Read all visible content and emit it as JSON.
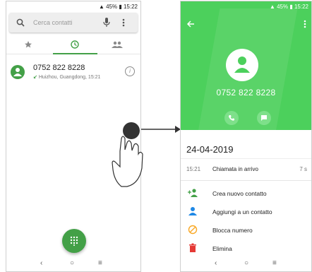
{
  "left_phone": {
    "status": {
      "text": "▲  45% ▮ 15:22"
    },
    "search": {
      "placeholder": "Cerca contatti"
    },
    "tabs": [
      "favorites",
      "recent",
      "contacts"
    ],
    "call_log": [
      {
        "number": "0752 822 8228",
        "detail": "Huizhou, Guangdong, 15:21"
      }
    ],
    "navbar": [
      "‹",
      "○",
      "≡"
    ]
  },
  "right_phone": {
    "status": {
      "text": "▲  45% ▮ 15:22"
    },
    "contact_number": "0752 822 8228",
    "date": "24-04-2019",
    "call": {
      "time": "15:21",
      "type": "Chiamata in arrivo",
      "duration": "7 s"
    },
    "actions": [
      {
        "label": "Crea nuovo contatto",
        "icon": "add-person-icon",
        "color": "#43a047"
      },
      {
        "label": "Aggiungi a un contatto",
        "icon": "person-icon",
        "color": "#1e88e5"
      },
      {
        "label": "Blocca numero",
        "icon": "block-icon",
        "color": "#f9a825"
      },
      {
        "label": "Elimina",
        "icon": "trash-icon",
        "color": "#e53935"
      }
    ],
    "navbar": [
      "‹",
      "○",
      "≡"
    ]
  },
  "colors": {
    "accent": "#43a047",
    "header": "#4cd05c"
  }
}
